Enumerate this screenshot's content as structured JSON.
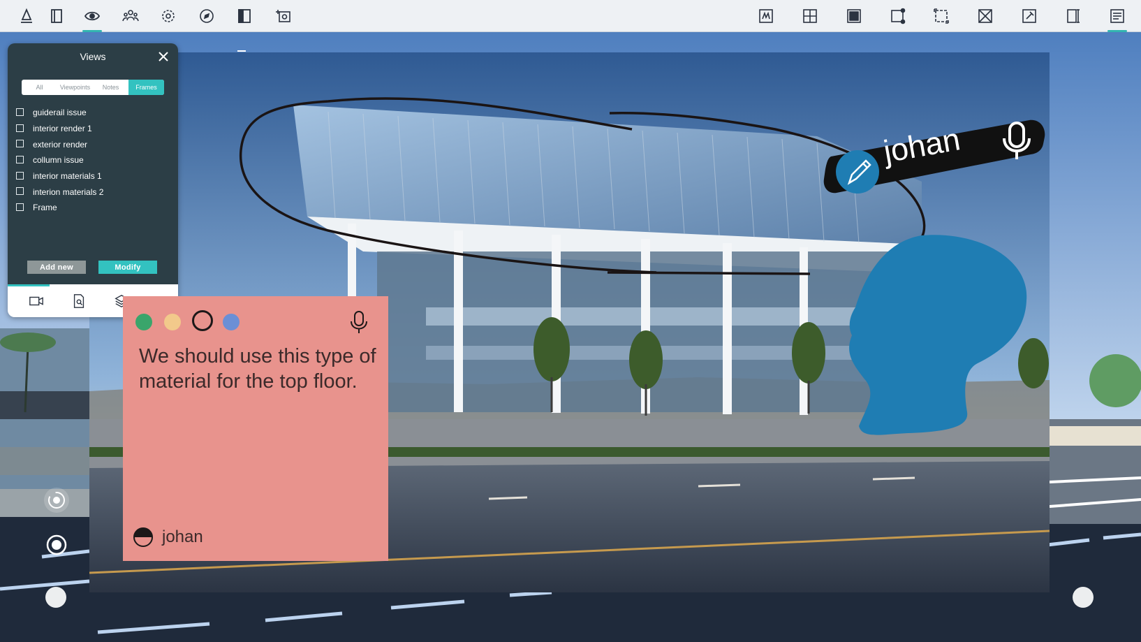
{
  "toolbar": {
    "left_icons": [
      "marker-icon",
      "panel-icon",
      "eye-icon",
      "people-icon",
      "settings-icon",
      "compass-icon",
      "split-view-icon",
      "camera-add-icon"
    ],
    "active_left": "eye-icon",
    "right_icons": [
      "sketch-icon",
      "add-frame-icon",
      "fill-frame-icon",
      "frame-handle-icon",
      "frame-resize-icon",
      "frame-close-icon",
      "frame-pin-icon",
      "side-panel-icon",
      "list-panel-icon"
    ],
    "active_right": "list-panel-icon",
    "accent": "#33b5b0"
  },
  "views_panel": {
    "title": "Views",
    "tabs": [
      {
        "label": "All",
        "active": false
      },
      {
        "label": "Viewpoints",
        "active": false
      },
      {
        "label": "Notes",
        "active": false
      },
      {
        "label": "Frames",
        "active": true
      }
    ],
    "items": [
      {
        "label": "guiderail issue",
        "checked": false
      },
      {
        "label": "interior render 1",
        "checked": false
      },
      {
        "label": "exterior render",
        "checked": false
      },
      {
        "label": "collumn issue",
        "checked": false
      },
      {
        "label": "interior materials 1",
        "checked": false
      },
      {
        "label": "interion materials 2",
        "checked": false
      },
      {
        "label": "Frame",
        "checked": false
      }
    ],
    "add_label": "Add new",
    "modify_label": "Modify",
    "footer_icons": [
      "video-camera-icon",
      "search-document-icon",
      "layers-icon",
      "view-settings-icon"
    ],
    "bg_color": "#2c3e46",
    "accent": "#33c2c0"
  },
  "note": {
    "text": "We should use this type of material for the top floor.",
    "author": "johan",
    "bg_color": "#e8938d",
    "colors": [
      "#3aa56b",
      "#f2c98b",
      "#e8938d",
      "#6b8fd6"
    ],
    "selected_color": "#e8938d"
  },
  "user_tag": {
    "name": "johan",
    "color": "#1f7db3"
  },
  "nav_controls": [
    "rotate-icon",
    "record-icon",
    "joystick-left",
    "joystick-right"
  ]
}
